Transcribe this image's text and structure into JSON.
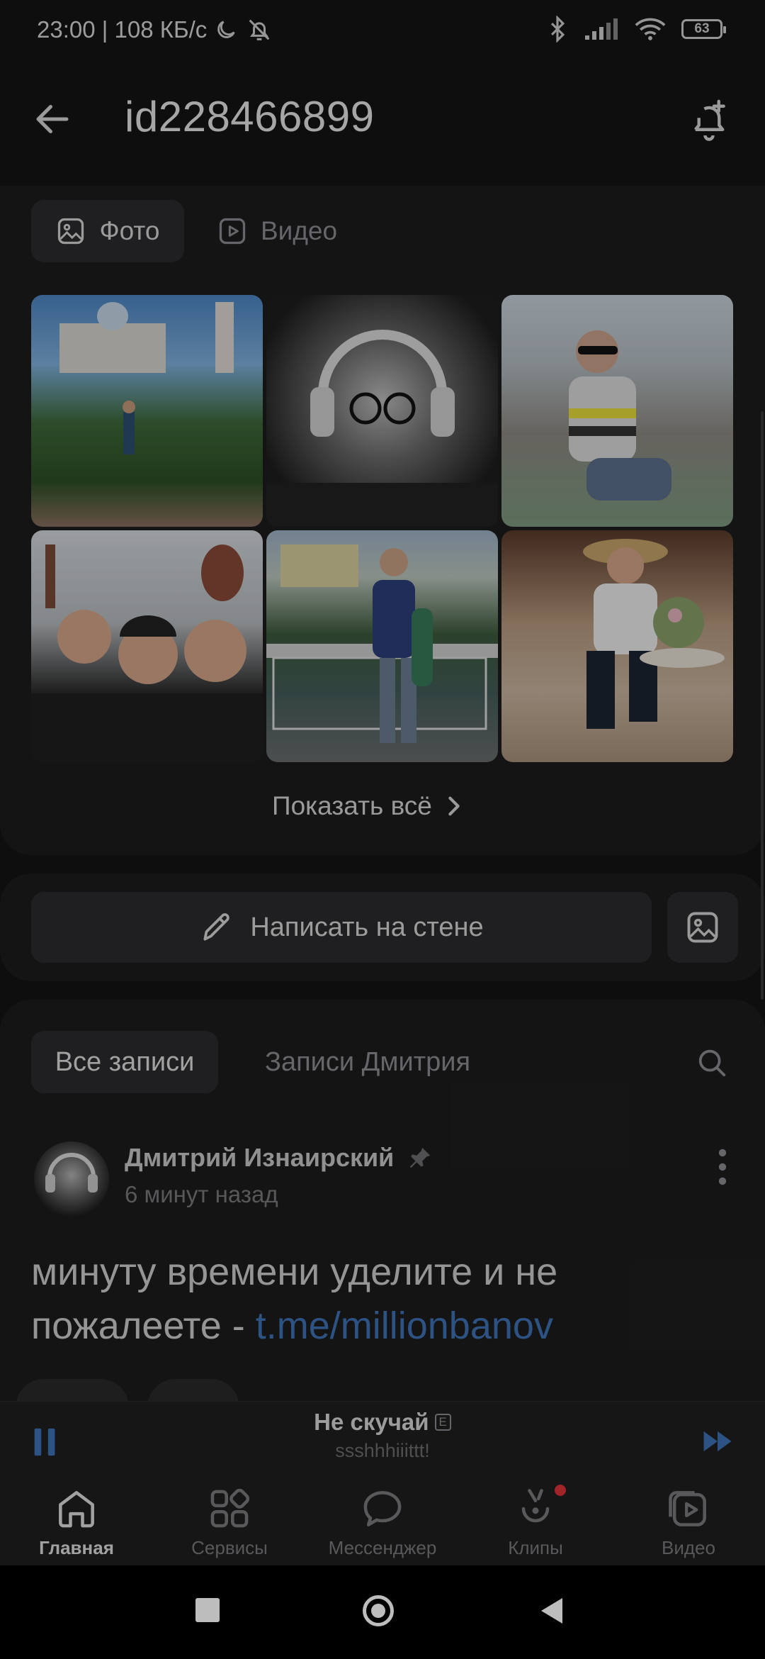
{
  "status": {
    "left": "23:00 | 108 КБ/с",
    "battery": "63"
  },
  "header": {
    "title": "id228466899"
  },
  "media_tabs": [
    {
      "label": "Фото",
      "icon": "photo-icon",
      "active": true
    },
    {
      "label": "Видео",
      "icon": "video-icon",
      "active": false
    }
  ],
  "photos": [
    {
      "alt": "Man in front of cathedral"
    },
    {
      "alt": "Leopard with headphones"
    },
    {
      "alt": "Man in sunglasses"
    },
    {
      "alt": "Three friends selfie"
    },
    {
      "alt": "Man on bridge by fountain"
    },
    {
      "alt": "Man in straw hat"
    }
  ],
  "photos_show_all": "Показать всё",
  "wall": {
    "write_label": "Написать на стене"
  },
  "feed_tabs": [
    {
      "label": "Все записи",
      "active": true
    },
    {
      "label": "Записи Дмитрия",
      "active": false
    }
  ],
  "post": {
    "author": "Дмитрий Изнаирский",
    "time": "6 минут назад",
    "text": "минуту времени уделите и не пожалеете - ",
    "link": "t.me/millionbanov"
  },
  "player": {
    "title": "Не скучай",
    "explicit_badge": "E",
    "artist": "ssshhhiiittt!"
  },
  "nav": [
    {
      "label": "Главная",
      "icon": "home-icon",
      "active": true
    },
    {
      "label": "Сервисы",
      "icon": "services-icon",
      "active": false
    },
    {
      "label": "Мессенджер",
      "icon": "messenger-icon",
      "active": false
    },
    {
      "label": "Клипы",
      "icon": "clips-icon",
      "active": false
    },
    {
      "label": "Видео",
      "icon": "video-icon",
      "active": false
    }
  ],
  "colors": {
    "accent": "#3f73b8",
    "background": "#141414",
    "card": "#1d1d1e",
    "badge": "#e0323a"
  }
}
